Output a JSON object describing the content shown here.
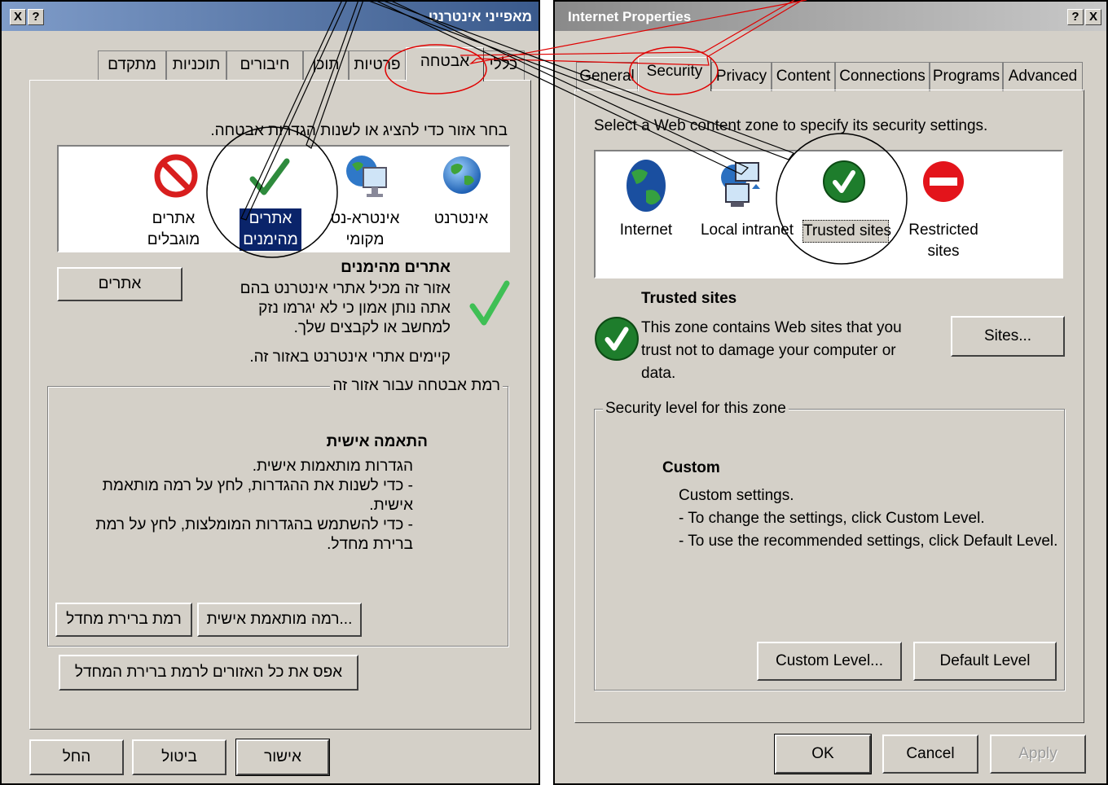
{
  "hebrew": {
    "title": "מאפייני אינטרנט",
    "help_btn": "?",
    "close_btn": "X",
    "tabs": [
      "כללי",
      "אבטחה",
      "פרטיות",
      "תוכן",
      "חיבורים",
      "תוכניות",
      "מתקדם"
    ],
    "active_tab": "אבטחה",
    "instruction": "בחר אזור כדי להציג או לשנות הגדרות אבטחה.",
    "zones": {
      "internet": "אינטרנט",
      "intranet_line1": "אינטרא-נט",
      "intranet_line2": "מקומי",
      "trusted_line1": "אתרים",
      "trusted_line2": "מהימנים",
      "restricted_line1": "אתרים",
      "restricted_line2": "מוגבלים"
    },
    "zone_heading": "אתרים מהימנים",
    "zone_desc_1": "אזור זה מכיל אתרי אינטרנט בהם",
    "zone_desc_2": "אתה נותן אמון כי לא יגרמו נזק",
    "zone_desc_3": "למחשב או לקבצים שלך.",
    "zone_desc_4": "קיימים אתרי אינטרנט באזור זה.",
    "sites_btn": "אתרים",
    "level_group": "רמת אבטחה עבור אזור זה",
    "custom_heading": "התאמה אישית",
    "custom_1": "הגדרות מותאמות אישית.",
    "custom_2": "- כדי לשנות את ההגדרות, לחץ על רמה מותאמת",
    "custom_3": "אישית.",
    "custom_4": "- כדי להשתמש בהגדרות המומלצות, לחץ על רמת",
    "custom_5": "ברירת מחדל.",
    "custom_level_btn": "רמה מותאמת אישית...",
    "default_level_btn": "רמת ברירת מחדל",
    "reset_all_btn": "אפס את כל האזורים לרמת ברירת המחדל",
    "ok_btn": "אישור",
    "cancel_btn": "ביטול",
    "apply_btn": "החל"
  },
  "english": {
    "title": "Internet Properties",
    "help_btn": "?",
    "close_btn": "X",
    "tabs": [
      "General",
      "Security",
      "Privacy",
      "Content",
      "Connections",
      "Programs",
      "Advanced"
    ],
    "active_tab": "Security",
    "instruction": "Select a Web content zone to specify its security settings.",
    "zones": {
      "internet": "Internet",
      "intranet": "Local intranet",
      "trusted": "Trusted sites",
      "restricted_line1": "Restricted",
      "restricted_line2": "sites"
    },
    "zone_heading": "Trusted sites",
    "zone_desc_1": "This zone contains Web sites that you",
    "zone_desc_2": "trust not to damage your computer or",
    "zone_desc_3": "data.",
    "sites_btn": "Sites...",
    "level_group": "Security level for this zone",
    "custom_heading": "Custom",
    "custom_1": "Custom settings.",
    "custom_2": "- To change the settings, click Custom Level.",
    "custom_3": "- To use the recommended settings, click Default Level.",
    "custom_level_btn": "Custom Level...",
    "default_level_btn": "Default Level",
    "ok_btn": "OK",
    "cancel_btn": "Cancel",
    "apply_btn": "Apply"
  },
  "colors": {
    "dialog_bg": "#d4d0c8",
    "selection": "#0a246a",
    "annotation_red": "#e00000",
    "annotation_black": "#000000"
  },
  "icons": [
    "trusted-check-icon",
    "restricted-icon",
    "globe-icon",
    "intranet-icon"
  ]
}
